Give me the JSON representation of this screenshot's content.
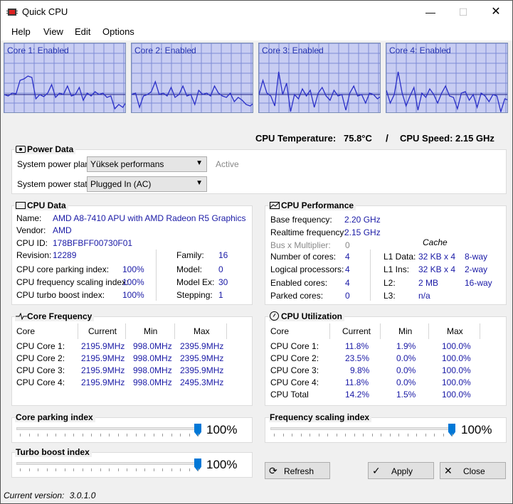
{
  "window": {
    "title": "Quick CPU"
  },
  "menu": [
    "Help",
    "View",
    "Edit",
    "Options"
  ],
  "cores": [
    {
      "label": "Core 1: Enabled"
    },
    {
      "label": "Core 2: Enabled"
    },
    {
      "label": "Core 3: Enabled"
    },
    {
      "label": "Core 4: Enabled"
    }
  ],
  "readout": {
    "temp_label": "CPU Temperature:",
    "temp_value": "75.8°C",
    "sep": "/",
    "speed_label": "CPU Speed:",
    "speed_value": "2.15 GHz"
  },
  "power": {
    "title": "Power Data",
    "plan_label": "System power plan:",
    "plan_value": "Yüksek performans",
    "plan_status": "Active",
    "state_label": "System power state:",
    "state_value": "Plugged In (AC)"
  },
  "cpu_data": {
    "title": "CPU Data",
    "name_label": "Name:",
    "name_value": "AMD A8-7410 APU with AMD Radeon R5 Graphics",
    "vendor_label": "Vendor:",
    "vendor_value": "AMD",
    "id_label": "CPU ID:",
    "id_value": "178BFBFF00730F01",
    "revision_label": "Revision:",
    "revision_value": "12289",
    "family_label": "Family:",
    "family_value": "16",
    "parking_label": "CPU core parking index:",
    "parking_value": "100%",
    "model_label": "Model:",
    "model_value": "0",
    "freqscale_label": "CPU frequency scaling index:",
    "freqscale_value": "100%",
    "modelex_label": "Model Ex:",
    "modelex_value": "30",
    "turbo_label": "CPU turbo boost index:",
    "turbo_value": "100%",
    "stepping_label": "Stepping:",
    "stepping_value": "1"
  },
  "perf": {
    "title": "CPU Performance",
    "base_label": "Base frequency:",
    "base_value": "2.20 GHz",
    "realtime_label": "Realtime frequency:",
    "realtime_value": "2.15 GHz",
    "bus_label": "Bus x Multiplier:",
    "bus_value": "0",
    "cache_title": "Cache",
    "cores_label": "Number of cores:",
    "cores_value": "4",
    "logical_label": "Logical processors:",
    "logical_value": "4",
    "enabled_label": "Enabled cores:",
    "enabled_value": "4",
    "parked_label": "Parked cores:",
    "parked_value": "0",
    "l1d_label": "L1 Data:",
    "l1d_size": "32 KB x 4",
    "l1d_way": "8-way",
    "l1i_label": "L1 Ins:",
    "l1i_size": "32 KB x 4",
    "l1i_way": "2-way",
    "l2_label": "L2:",
    "l2_size": "2 MB",
    "l2_way": "16-way",
    "l3_label": "L3:",
    "l3_size": "n/a"
  },
  "freq": {
    "title": "Core Frequency",
    "headers": [
      "Core",
      "Current",
      "Min",
      "Max"
    ],
    "rows": [
      [
        "CPU Core 1:",
        "2195.9MHz",
        "998.0MHz",
        "2395.9MHz"
      ],
      [
        "CPU Core 2:",
        "2195.9MHz",
        "998.0MHz",
        "2395.9MHz"
      ],
      [
        "CPU Core 3:",
        "2195.9MHz",
        "998.0MHz",
        "2395.9MHz"
      ],
      [
        "CPU Core 4:",
        "2195.9MHz",
        "998.0MHz",
        "2495.3MHz"
      ]
    ]
  },
  "util": {
    "title": "CPU Utilization",
    "headers": [
      "Core",
      "Current",
      "Min",
      "Max"
    ],
    "rows": [
      [
        "CPU Core 1:",
        "11.8%",
        "1.9%",
        "100.0%"
      ],
      [
        "CPU Core 2:",
        "23.5%",
        "0.0%",
        "100.0%"
      ],
      [
        "CPU Core 3:",
        "9.8%",
        "0.0%",
        "100.0%"
      ],
      [
        "CPU Core 4:",
        "11.8%",
        "0.0%",
        "100.0%"
      ],
      [
        "CPU Total",
        "14.2%",
        "1.5%",
        "100.0%"
      ]
    ]
  },
  "sliders": {
    "parking": {
      "title": "Core parking index",
      "value_label": "100%",
      "level": 1.0
    },
    "freqscale": {
      "title": "Frequency scaling index",
      "value_label": "100%",
      "level": 1.0
    },
    "turbo": {
      "title": "Turbo boost index",
      "value_label": "100%",
      "level": 1.0
    }
  },
  "buttons": {
    "refresh": "Refresh",
    "apply": "Apply",
    "close": "Close"
  },
  "status": {
    "version_label": "Current version:",
    "version_value": "3.0.1.0"
  },
  "colors": {
    "graph_bg": "#c8cdf2",
    "graph_line": "#2a2fc8",
    "accent": "#0078d7",
    "value_blue": "#1a1aa6"
  }
}
